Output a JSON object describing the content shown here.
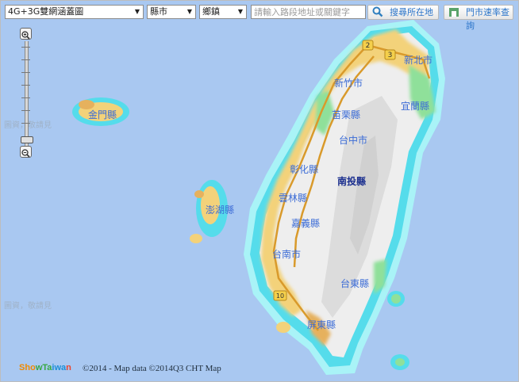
{
  "toolbar": {
    "layer_select": "4G+3G雙網涵蓋圖",
    "county_select": "縣市",
    "township_select": "鄉鎮",
    "search_placeholder": "請輸入路段地址或關鍵字",
    "locate_button": "搜尋所在地",
    "store_button": "門市速率查詢"
  },
  "map": {
    "labels": {
      "new_taipei": "新北市",
      "hsinchu": "新竹市",
      "yilan": "宜蘭縣",
      "kinmen": "金門縣",
      "miaoli": "苗栗縣",
      "taichung": "台中市",
      "changhua": "彰化縣",
      "nantou": "南投縣",
      "yunlin": "雲林縣",
      "penghu": "澎湖縣",
      "chiayi": "嘉義縣",
      "tainan": "台南市",
      "taitung": "台東縣",
      "pingtung": "屏東縣"
    },
    "route_shields": [
      "2",
      "3",
      "10"
    ],
    "ghost_text": [
      "圖資，敬請見",
      "圖資，敬請見"
    ],
    "colors": {
      "sea": "#a9c8f1",
      "land": "#eeeeee",
      "mountain": "#dcdcdc",
      "coverage_light": "#a9f3f7",
      "coverage_cyan": "#55dceb",
      "coverage_green": "#8fe09a",
      "coverage_yellow": "#f3d27a",
      "coverage_orange": "#e6b15d",
      "label_blue": "#3c6cd6",
      "label_dark": "#1b2f8f"
    }
  },
  "footer": {
    "logo": "ShowTaiwan",
    "credit": "©2014 - Map data ©2014Q3 CHT Map"
  }
}
